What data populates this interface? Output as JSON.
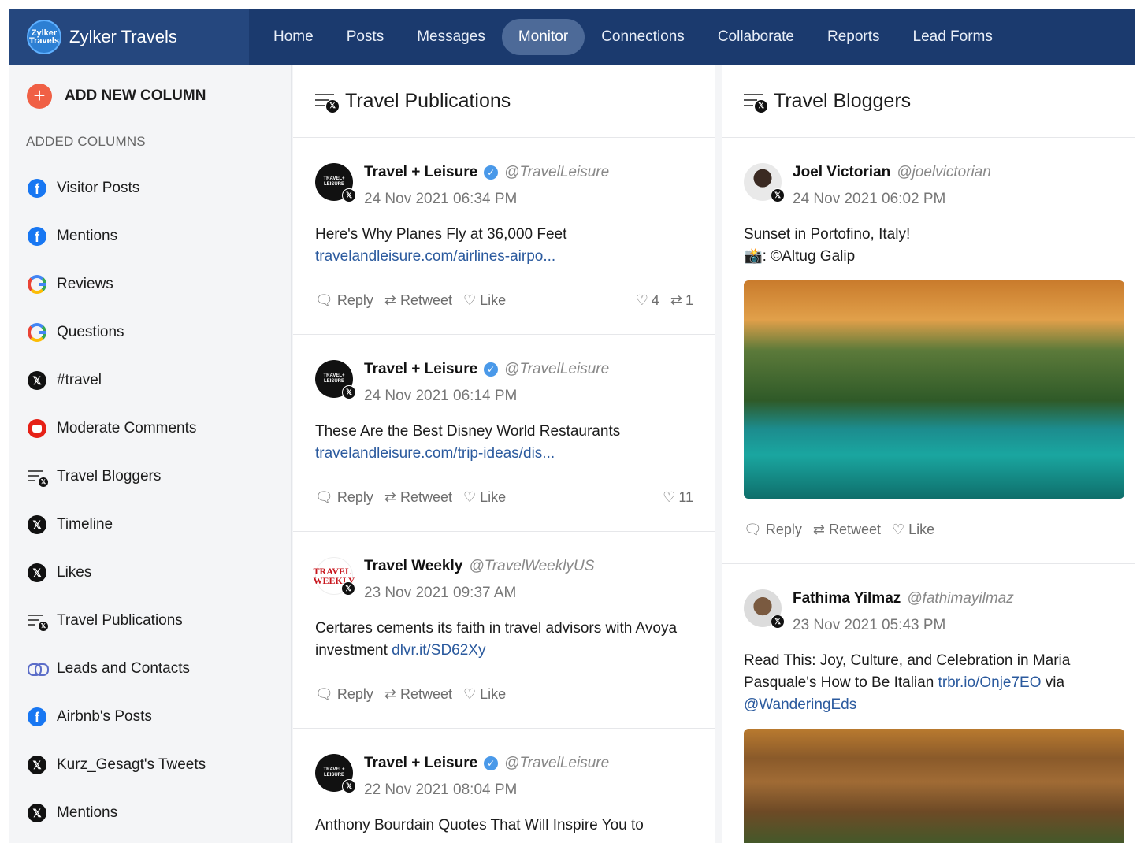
{
  "brand": {
    "name": "Zylker Travels",
    "logo_text": "Zylker Travels"
  },
  "nav": [
    {
      "label": "Home",
      "active": false
    },
    {
      "label": "Posts",
      "active": false
    },
    {
      "label": "Messages",
      "active": false
    },
    {
      "label": "Monitor",
      "active": true
    },
    {
      "label": "Connections",
      "active": false
    },
    {
      "label": "Collaborate",
      "active": false
    },
    {
      "label": "Reports",
      "active": false
    },
    {
      "label": "Lead Forms",
      "active": false
    }
  ],
  "sidebar": {
    "add_label": "ADD NEW COLUMN",
    "section_label": "ADDED COLUMNS",
    "items": [
      {
        "label": "Visitor Posts",
        "icon": "facebook-icon"
      },
      {
        "label": "Mentions",
        "icon": "facebook-icon"
      },
      {
        "label": "Reviews",
        "icon": "google-icon"
      },
      {
        "label": "Questions",
        "icon": "google-icon"
      },
      {
        "label": "#travel",
        "icon": "x-icon"
      },
      {
        "label": "Moderate Comments",
        "icon": "youtube-icon"
      },
      {
        "label": "Travel Bloggers",
        "icon": "x-list-icon"
      },
      {
        "label": "Timeline",
        "icon": "x-icon"
      },
      {
        "label": "Likes",
        "icon": "x-icon"
      },
      {
        "label": "Travel Publications",
        "icon": "x-list-icon"
      },
      {
        "label": "Leads and Contacts",
        "icon": "link-icon"
      },
      {
        "label": "Airbnb's Posts",
        "icon": "facebook-icon"
      },
      {
        "label": "Kurz_Gesagt's Tweets",
        "icon": "x-icon"
      },
      {
        "label": "Mentions",
        "icon": "x-icon"
      }
    ]
  },
  "actions": {
    "reply": "Reply",
    "retweet": "Retweet",
    "like": "Like"
  },
  "columns": [
    {
      "title": "Travel Publications",
      "posts": [
        {
          "name": "Travel + Leisure",
          "handle": "@TravelLeisure",
          "verified": true,
          "date": "24 Nov 2021 06:34 PM",
          "text": "Here's Why Planes Fly at 36,000 Feet",
          "link": "travelandleisure.com/airlines-airpo...",
          "likes": "4",
          "retweets": "1",
          "avatar_text": "TRAVEL+ LEISURE"
        },
        {
          "name": "Travel + Leisure",
          "handle": "@TravelLeisure",
          "verified": true,
          "date": "24 Nov 2021 06:14 PM",
          "text": "These Are the Best Disney World Restaurants",
          "link": "travelandleisure.com/trip-ideas/dis...",
          "likes": "11",
          "avatar_text": "TRAVEL+ LEISURE"
        },
        {
          "name": "Travel Weekly",
          "handle": "@TravelWeeklyUS",
          "verified": false,
          "date": "23 Nov 2021 09:37 AM",
          "text": "Certares cements its faith in travel advisors with Avoya investment ",
          "link": "dlvr.it/SD62Xy",
          "avatar_text": "TRAVEL WEEKLY"
        },
        {
          "name": "Travel + Leisure",
          "handle": "@TravelLeisure",
          "verified": true,
          "date": "22 Nov 2021 08:04 PM",
          "text": "Anthony Bourdain Quotes That Will Inspire You to",
          "avatar_text": "TRAVEL+ LEISURE"
        }
      ]
    },
    {
      "title": "Travel Bloggers",
      "posts": [
        {
          "name": "Joel Victorian",
          "handle": "@joelvictorian",
          "date": "24 Nov 2021 06:02 PM",
          "text_line1": "Sunset in Portofino, Italy!",
          "text_line2": "📸: ©Altug Galip"
        },
        {
          "name": "Fathima Yilmaz",
          "handle": "@fathimayilmaz",
          "date": "23 Nov 2021 05:43 PM",
          "text": "Read This: Joy, Culture, and Celebration in Maria Pasquale's How to Be Italian ",
          "link": "trbr.io/Onje7EO",
          "text_after": " via ",
          "mention": "@WanderingEds"
        }
      ]
    }
  ],
  "colors": {
    "nav_bg": "#1b3a6e",
    "nav_active": "#4d6a98",
    "add_button": "#f06045",
    "link": "#2b5a9e",
    "verified": "#4a99e9"
  }
}
